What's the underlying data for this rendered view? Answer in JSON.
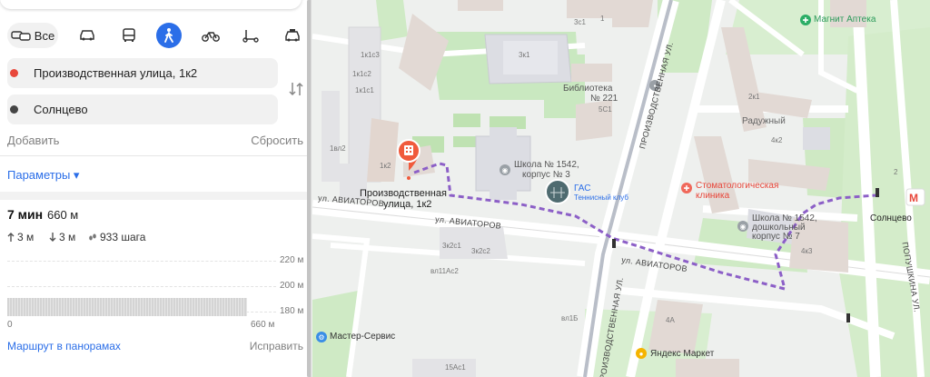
{
  "modes": {
    "all_label": "Все",
    "items": [
      {
        "name": "car-mode-button",
        "icon": "car-icon"
      },
      {
        "name": "bus-mode-button",
        "icon": "bus-icon"
      },
      {
        "name": "walk-mode-button",
        "icon": "pedestrian-icon",
        "active": true
      },
      {
        "name": "bike-mode-button",
        "icon": "bicycle-icon"
      },
      {
        "name": "scooter-mode-button",
        "icon": "scooter-icon"
      },
      {
        "name": "taxi-mode-button",
        "icon": "taxi-icon"
      }
    ]
  },
  "route": {
    "from": "Производственная улица, 1к2",
    "to": "Солнцево",
    "add_label": "Добавить",
    "reset_label": "Сбросить",
    "params_label": "Параметры ▾",
    "time": "7 мин",
    "distance": "660 м",
    "ascent": "3 м",
    "descent": "3 м",
    "steps": "933 шага"
  },
  "elevation": {
    "labels": [
      "220 м",
      "200 м",
      "180 м"
    ],
    "x_start": "0",
    "x_end": "660 м"
  },
  "footer": {
    "panorama_label": "Маршрут в панорамах",
    "fix_label": "Исправить"
  },
  "colors": {
    "accent": "#2b6ee8",
    "start_dot": "#e8473b",
    "end_dot": "#444444",
    "route_line": "#8c5fc7",
    "pin": "#f05a3c"
  },
  "map": {
    "labels": {
      "pin_name_1": "Производственная",
      "pin_name_2": "улица, 1к2",
      "school1542_1": "Школа № 1542,",
      "school1542_2": "корпус № 3",
      "gas": "ГАС",
      "tennis": "Теннисный клуб",
      "library_1": "Библиотека",
      "library_2": "№ 221",
      "magnit": "Магнит Аптека",
      "raduzhny": "Радужный",
      "stomat_1": "Стоматологическая",
      "stomat_2": "клиника",
      "school_pre_1": "Школа № 1542,",
      "school_pre_2": "дошкольный",
      "school_pre_3": "корпус № 7",
      "metro": "Солнцево",
      "master": "Мастер-Сервис",
      "yandex_market": "Яндекс Маркет",
      "aviatorov_1": "ул. АВИАТОРОВ",
      "aviatorov_2": "ул. АВИАТОРОВ",
      "aviatorov_3": "ул. АВИАТОРОВ",
      "proizv_1": "ПРОИЗВОДСТВЕННАЯ УЛ.",
      "proizv_2": "ПРОИЗВОДСТВЕННАЯ УЛ.",
      "popushkina": "ПОПУШКИНА УЛ.",
      "b_3k1": "3к1",
      "b_3c1": "3с1",
      "b_1k1c3": "1к1с3",
      "b_1k1c2": "1к1с2",
      "b_1k1c1": "1к1с1",
      "b_1k2": "1к2",
      "b_1vl2": "1вл2",
      "b_5c1": "5С1",
      "b_1": "1",
      "b_2k1": "2к1",
      "b_4k2": "4к2",
      "b_4k3": "4к3",
      "b_3k2c1": "3к2с1",
      "b_3k2c2": "3к2с2",
      "b_vl11ac2": "вл11Ас2",
      "b_vl1b": "вл1Б",
      "b_4a": "4А",
      "b_15ac1": "15Ас1",
      "b_2": "2"
    }
  }
}
